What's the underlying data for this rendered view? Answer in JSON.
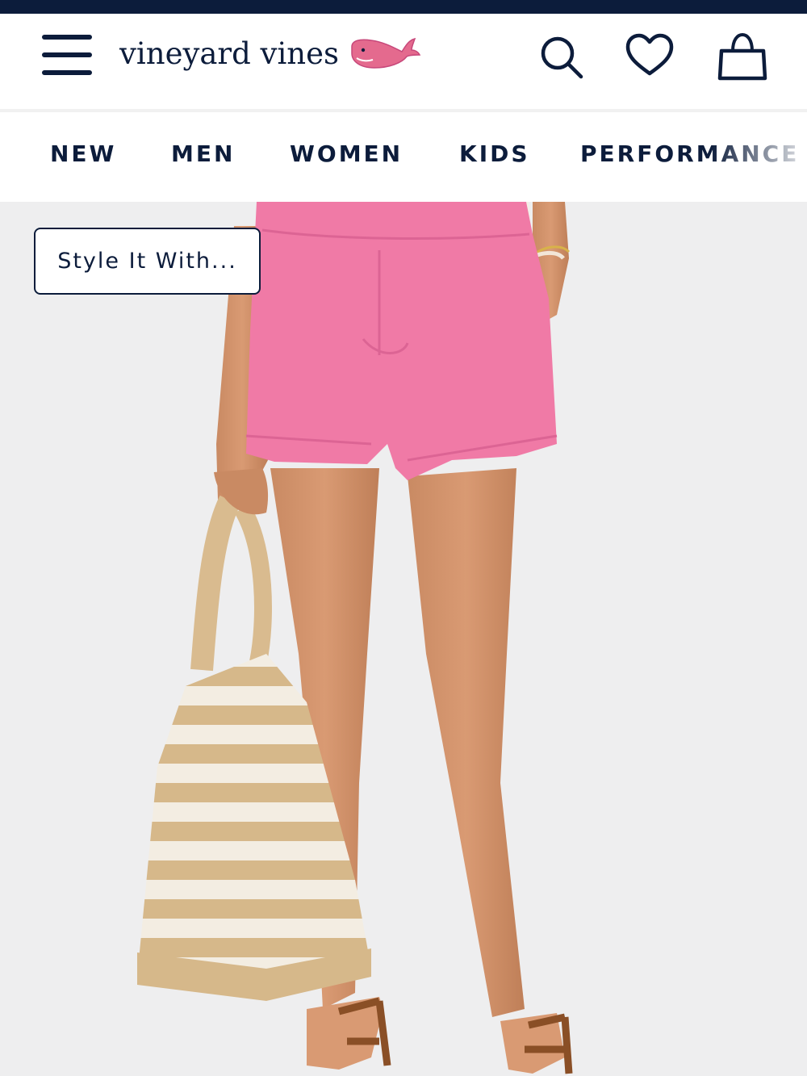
{
  "brand": {
    "name": "vineyard vines",
    "logo_icon": "whale-icon",
    "accent": "#0c1c3b",
    "whale_color": "#e46a8e"
  },
  "header": {
    "icons": [
      "menu-icon",
      "search-icon",
      "heart-icon",
      "shopping-bag-icon"
    ]
  },
  "nav": {
    "items": [
      {
        "label": "NEW"
      },
      {
        "label": "MEN"
      },
      {
        "label": "WOMEN"
      },
      {
        "label": "KIDS"
      },
      {
        "label": "PERFORMANCE"
      }
    ]
  },
  "hero": {
    "style_button_label": "Style It With...",
    "shorts_color": "#f07aa6"
  }
}
